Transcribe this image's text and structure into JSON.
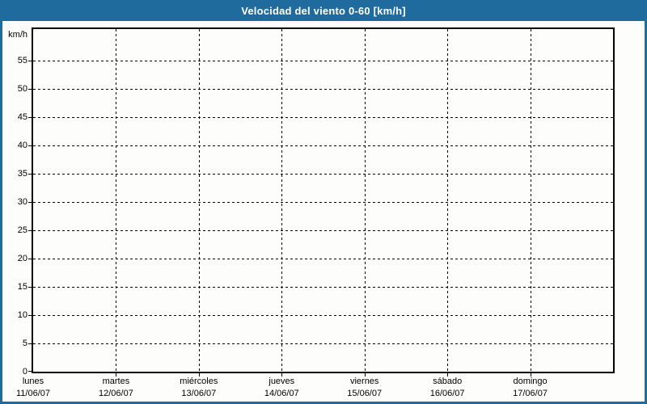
{
  "window": {
    "title": "Velocidad del viento 0-60 [km/h]"
  },
  "colors": {
    "titlebar_bg": "#1f6b9e",
    "frame": "#1f6b9e",
    "title_text": "#ffffff",
    "plot_border": "#000000",
    "grid": "#000000",
    "background": "#fdfdfb",
    "label_text": "#000000"
  },
  "chart_data": {
    "type": "line",
    "title": "Velocidad del viento 0-60 [km/h]",
    "ylabel": "km/h",
    "xlabel": "",
    "ylim": [
      0,
      60
    ],
    "ytick_step": 5,
    "yticks": [
      0,
      5,
      10,
      15,
      20,
      25,
      30,
      35,
      40,
      45,
      50,
      55
    ],
    "grid": true,
    "grid_style": "dashed",
    "legend": null,
    "x_categories": [
      {
        "day": "lunes",
        "date": "11/06/07"
      },
      {
        "day": "martes",
        "date": "12/06/07"
      },
      {
        "day": "miércoles",
        "date": "13/06/07"
      },
      {
        "day": "jueves",
        "date": "14/06/07"
      },
      {
        "day": "viernes",
        "date": "15/06/07"
      },
      {
        "day": "sábado",
        "date": "16/06/07"
      },
      {
        "day": "domingo",
        "date": "17/06/07"
      }
    ],
    "series": []
  }
}
